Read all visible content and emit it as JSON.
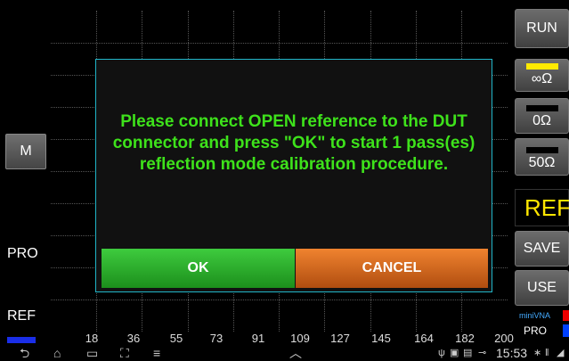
{
  "left_panel": {
    "m_label": "M",
    "pro_label": "PRO",
    "ref_label": "REF"
  },
  "right_panel": {
    "run_label": "RUN",
    "open_label": "∞Ω",
    "short_label": "0Ω",
    "load_label": "50Ω",
    "ref_label": "REF",
    "save_label": "SAVE",
    "use_label": "USE",
    "minivna_label": "miniVNA",
    "pro_label": "PRO",
    "colors": {
      "open_swatch": "#ffea00",
      "short_swatch": "#000000",
      "load_swatch": "#000000",
      "ref_text": "#ffe600"
    }
  },
  "x_axis": {
    "ticks": [
      "18",
      "36",
      "55",
      "73",
      "91",
      "109",
      "127",
      "145",
      "164",
      "182",
      "200"
    ]
  },
  "dialog": {
    "message": "Please connect OPEN reference to the DUT connector and press \"OK\" to start 1 pass(es) reflection mode calibration procedure.",
    "ok_label": "OK",
    "cancel_label": "CANCEL",
    "colors": {
      "border": "#21b5c8",
      "message": "#3ee21b",
      "ok": "#2eb22e",
      "cancel": "#e0701f"
    }
  },
  "navbar": {
    "back_icon": "back-icon",
    "home_icon": "home-icon",
    "recents_icon": "recents-icon",
    "screenshot_icon": "screenshot-icon",
    "menu_icon": "menu-icon",
    "up_icon": "chevron-up-icon",
    "time": "15:53"
  }
}
